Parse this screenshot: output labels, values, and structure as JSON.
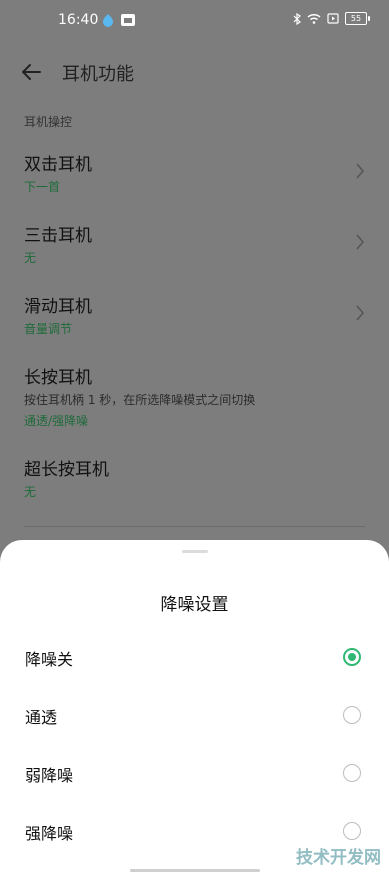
{
  "status_bar": {
    "time": "16:40",
    "battery": "55"
  },
  "header": {
    "title": "耳机功能"
  },
  "section": {
    "label": "耳机操控"
  },
  "rows": [
    {
      "name": "双击耳机",
      "value": "下一首"
    },
    {
      "name": "三击耳机",
      "value": "无"
    },
    {
      "name": "滑动耳机",
      "value": "音量调节"
    },
    {
      "name": "长按耳机",
      "description": "按住耳机柄 1 秒，在所选降噪模式之间切换",
      "value": "通透/强降噪"
    },
    {
      "name": "超长按耳机",
      "value": "无"
    }
  ],
  "sheet": {
    "title": "降噪设置",
    "options": [
      {
        "label": "降噪关",
        "selected": true
      },
      {
        "label": "通透",
        "selected": false
      },
      {
        "label": "弱降噪",
        "selected": false
      },
      {
        "label": "强降噪",
        "selected": false
      }
    ]
  },
  "watermark": "技术开发网",
  "colors": {
    "accent": "#2eb872",
    "sub_text": "#1f6b3b"
  }
}
